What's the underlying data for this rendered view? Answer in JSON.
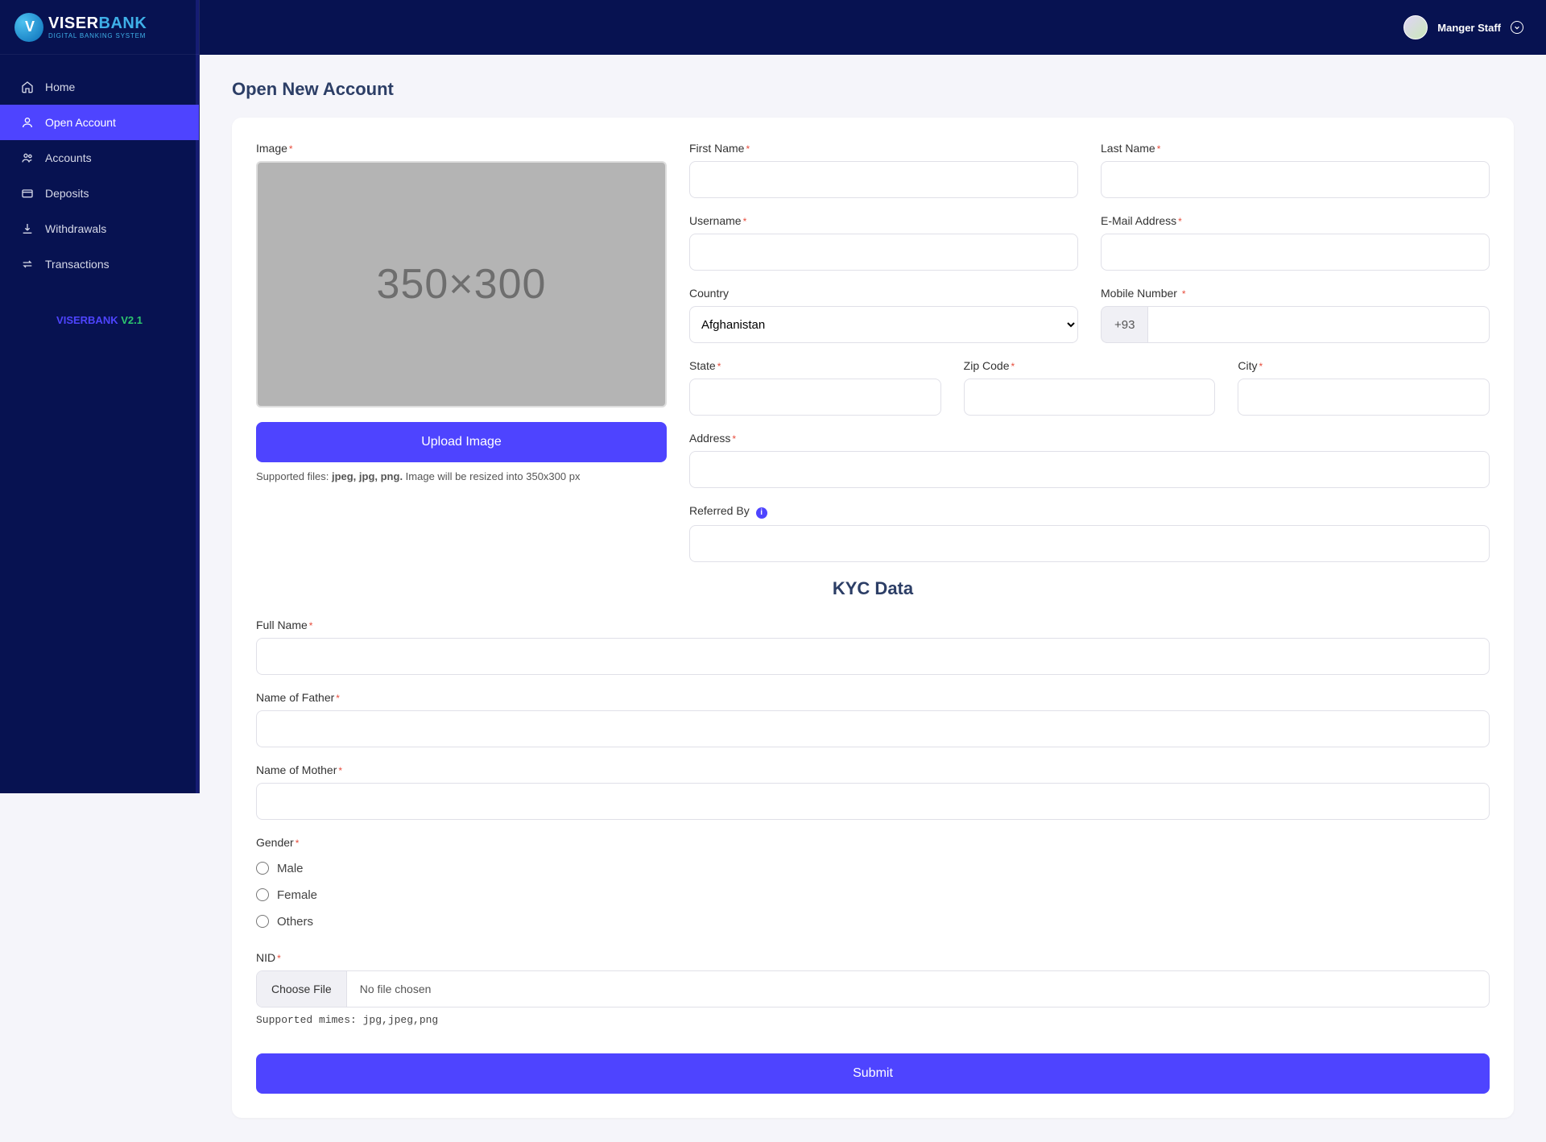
{
  "brand": {
    "viser": "VISER",
    "bank": "BANK",
    "tagline": "DIGITAL BANKING SYSTEM"
  },
  "sidebar": {
    "items": [
      {
        "label": "Home"
      },
      {
        "label": "Open Account"
      },
      {
        "label": "Accounts"
      },
      {
        "label": "Deposits"
      },
      {
        "label": "Withdrawals"
      },
      {
        "label": "Transactions"
      }
    ],
    "footer_brand": "VISERBANK",
    "footer_version": " V2.1"
  },
  "topbar": {
    "username": "Manger Staff"
  },
  "page": {
    "title": "Open New Account"
  },
  "form": {
    "image_label": "Image",
    "upload_btn": "Upload Image",
    "support_prefix": "Supported files: ",
    "support_types": "jpeg, jpg, png.",
    "support_suffix": " Image will be resized into 350x300 px",
    "placeholder_text": "350×300",
    "first_name": "First Name",
    "last_name": "Last Name",
    "username": "Username",
    "email": "E-Mail Address",
    "country": "Country",
    "country_value": "Afghanistan",
    "mobile": "Mobile Number",
    "dial_code": "+93",
    "state": "State",
    "zip": "Zip Code",
    "city": "City",
    "address": "Address",
    "referred": "Referred By",
    "kyc_title": "KYC Data",
    "full_name": "Full Name",
    "father": "Name of Father",
    "mother": "Name of Mother",
    "gender": "Gender",
    "gender_opts": [
      "Male",
      "Female",
      "Others"
    ],
    "nid": "NID",
    "choose_file": "Choose File",
    "no_file": "No file chosen",
    "mimes": "Supported mimes: jpg,jpeg,png",
    "submit": "Submit"
  }
}
